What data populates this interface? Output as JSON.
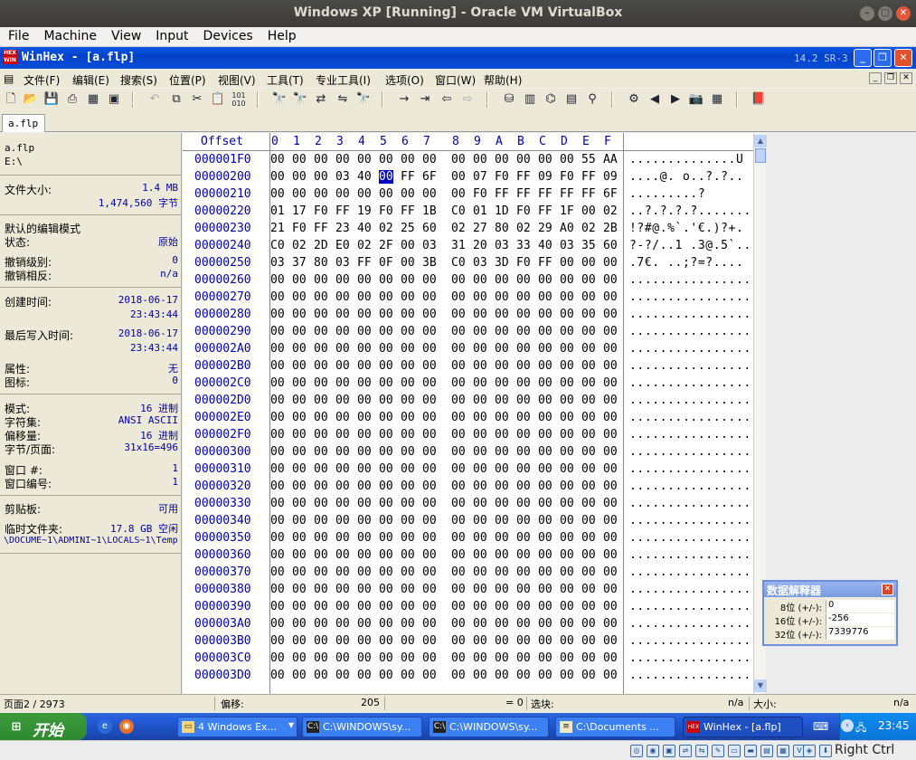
{
  "host": {
    "window_title": "Windows XP [Running] - Oracle VM VirtualBox",
    "menu": [
      "File",
      "Machine",
      "View",
      "Input",
      "Devices",
      "Help"
    ],
    "host_key": "Right Ctrl"
  },
  "app": {
    "title": "WinHex - [a.flp]",
    "version": "14.2 SR-3",
    "menu": [
      "文件(F)",
      "编辑(E)",
      "搜索(S)",
      "位置(P)",
      "视图(V)",
      "工具(T)",
      "专业工具(I)",
      "选项(O)",
      "窗口(W)",
      "帮助(H)"
    ],
    "tab_label": "a.flp"
  },
  "info": {
    "file_name": "a.flp",
    "path": "E:\\",
    "file_size_label": "文件大小:",
    "file_size_mb": "1.4 MB",
    "file_size_bytes": "1,474,560 字节",
    "default_edit_mode_label": "默认的编辑模式",
    "state_label": "状态:",
    "state_value": "原始",
    "undo_level_label": "撤销级别:",
    "undo_level_value": "0",
    "undo_reverse_label": "撤销相反:",
    "undo_reverse_value": "n/a",
    "created_label": "创建时间:",
    "created_date": "2018-06-17",
    "created_time": "23:43:44",
    "last_write_label": "最后写入时间:",
    "last_write_date": "2018-06-17",
    "last_write_time": "23:43:44",
    "attributes_label": "属性:",
    "attributes_value": "无",
    "icon_label": "图标:",
    "icon_value": "0",
    "mode_label": "模式:",
    "mode_value": "16 进制",
    "charset_label": "字符集:",
    "charset_value": "ANSI ASCII",
    "offset_label": "偏移量:",
    "offset_value": "16 进制",
    "bytes_per_page_label": "字节/页面:",
    "bytes_per_page_value": "31x16=496",
    "window_num_label": "窗口 #:",
    "window_num_value": "1",
    "window_count_label": "窗口编号:",
    "window_count_value": "1",
    "clipboard_label": "剪贴板:",
    "clipboard_value": "可用",
    "temp_folder_label": "临时文件夹:",
    "temp_folder_value": "17.8 GB 空闲",
    "temp_path": "\\DOCUME~1\\ADMINI~1\\LOCALS~1\\Temp"
  },
  "hex": {
    "offset_header": "Offset",
    "columns": [
      "0",
      "1",
      "2",
      "3",
      "4",
      "5",
      "6",
      "7",
      "8",
      "9",
      "A",
      "B",
      "C",
      "D",
      "E",
      "F"
    ],
    "rows": [
      {
        "offset": "000001F0",
        "bytes": "00 00 00 00 00 00 00 00 00 00 00 00 00 00 55 AA",
        "ascii": "..............U"
      },
      {
        "offset": "00000200",
        "bytes": "00 00 00 03 40 00 FF 6F 00 07 F0 FF 09 F0 FF 09",
        "ascii": "....@.  o..?.?.."
      },
      {
        "offset": "00000210",
        "bytes": "00 00 00 00 00 00 00 00 00 F0 FF FF FF FF FF 6F",
        "ascii": ".........?"
      },
      {
        "offset": "00000220",
        "bytes": "01 17 F0 FF 19 F0 FF 1B C0 01 1D F0 FF 1F 00 02",
        "ascii": "..?.?.?.?......."
      },
      {
        "offset": "00000230",
        "bytes": "21 F0 FF 23 40 02 25 60 02 27 80 02 29 A0 02 2B",
        "ascii": "!?#@.%`.'€.)?+."
      },
      {
        "offset": "00000240",
        "bytes": "C0 02 2D E0 02 2F 00 03 31 20 03 33 40 03 35 60",
        "ascii": "?-?/..1 .3@.5`.."
      },
      {
        "offset": "00000250",
        "bytes": "03 37 80 03 FF 0F 00 3B C0 03 3D F0 FF 00 00 00",
        "ascii": ".7€.  ..;?=?...."
      },
      {
        "offset": "00000260",
        "bytes": "00 00 00 00 00 00 00 00 00 00 00 00 00 00 00 00",
        "ascii": "................"
      },
      {
        "offset": "00000270",
        "bytes": "00 00 00 00 00 00 00 00 00 00 00 00 00 00 00 00",
        "ascii": "................"
      },
      {
        "offset": "00000280",
        "bytes": "00 00 00 00 00 00 00 00 00 00 00 00 00 00 00 00",
        "ascii": "................"
      },
      {
        "offset": "00000290",
        "bytes": "00 00 00 00 00 00 00 00 00 00 00 00 00 00 00 00",
        "ascii": "................"
      },
      {
        "offset": "000002A0",
        "bytes": "00 00 00 00 00 00 00 00 00 00 00 00 00 00 00 00",
        "ascii": "................"
      },
      {
        "offset": "000002B0",
        "bytes": "00 00 00 00 00 00 00 00 00 00 00 00 00 00 00 00",
        "ascii": "................"
      },
      {
        "offset": "000002C0",
        "bytes": "00 00 00 00 00 00 00 00 00 00 00 00 00 00 00 00",
        "ascii": "................"
      },
      {
        "offset": "000002D0",
        "bytes": "00 00 00 00 00 00 00 00 00 00 00 00 00 00 00 00",
        "ascii": "................"
      },
      {
        "offset": "000002E0",
        "bytes": "00 00 00 00 00 00 00 00 00 00 00 00 00 00 00 00",
        "ascii": "................"
      },
      {
        "offset": "000002F0",
        "bytes": "00 00 00 00 00 00 00 00 00 00 00 00 00 00 00 00",
        "ascii": "................"
      },
      {
        "offset": "00000300",
        "bytes": "00 00 00 00 00 00 00 00 00 00 00 00 00 00 00 00",
        "ascii": "................"
      },
      {
        "offset": "00000310",
        "bytes": "00 00 00 00 00 00 00 00 00 00 00 00 00 00 00 00",
        "ascii": "................"
      },
      {
        "offset": "00000320",
        "bytes": "00 00 00 00 00 00 00 00 00 00 00 00 00 00 00 00",
        "ascii": "................"
      },
      {
        "offset": "00000330",
        "bytes": "00 00 00 00 00 00 00 00 00 00 00 00 00 00 00 00",
        "ascii": "................"
      },
      {
        "offset": "00000340",
        "bytes": "00 00 00 00 00 00 00 00 00 00 00 00 00 00 00 00",
        "ascii": "................"
      },
      {
        "offset": "00000350",
        "bytes": "00 00 00 00 00 00 00 00 00 00 00 00 00 00 00 00",
        "ascii": "................"
      },
      {
        "offset": "00000360",
        "bytes": "00 00 00 00 00 00 00 00 00 00 00 00 00 00 00 00",
        "ascii": "................"
      },
      {
        "offset": "00000370",
        "bytes": "00 00 00 00 00 00 00 00 00 00 00 00 00 00 00 00",
        "ascii": "................"
      },
      {
        "offset": "00000380",
        "bytes": "00 00 00 00 00 00 00 00 00 00 00 00 00 00 00 00",
        "ascii": "................"
      },
      {
        "offset": "00000390",
        "bytes": "00 00 00 00 00 00 00 00 00 00 00 00 00 00 00 00",
        "ascii": "................"
      },
      {
        "offset": "000003A0",
        "bytes": "00 00 00 00 00 00 00 00 00 00 00 00 00 00 00 00",
        "ascii": "................"
      },
      {
        "offset": "000003B0",
        "bytes": "00 00 00 00 00 00 00 00 00 00 00 00 00 00 00 00",
        "ascii": "................"
      },
      {
        "offset": "000003C0",
        "bytes": "00 00 00 00 00 00 00 00 00 00 00 00 00 00 00 00",
        "ascii": "................"
      },
      {
        "offset": "000003D0",
        "bytes": "00 00 00 00 00 00 00 00 00 00 00 00 00 00 00 00",
        "ascii": "................"
      }
    ]
  },
  "interpreter": {
    "title": "数据解释器",
    "rows": [
      {
        "label": "8位 (+/-):",
        "value": "0"
      },
      {
        "label": "16位 (+/-):",
        "value": "-256"
      },
      {
        "label": "32位 (+/-):",
        "value": "7339776"
      }
    ]
  },
  "status": {
    "page": "页面2 / 2973",
    "offset_label": "偏移:",
    "offset_value": "205",
    "eq": "= 0",
    "selection_label": "选块:",
    "selection_value": "n/a",
    "size_label": "大小:",
    "size_value": "n/a"
  },
  "taskbar": {
    "start": "开始",
    "tasks": [
      "4 Windows Ex...",
      "C:\\WINDOWS\\sy...",
      "C:\\WINDOWS\\sy...",
      "C:\\Documents ...",
      "WinHex - [a.flp]"
    ],
    "clock": "23:45"
  },
  "icons": {
    "toolbar": [
      "new-icon",
      "open-icon",
      "save-icon",
      "print-icon",
      "properties-icon",
      "open-folder-icon",
      "undo-icon",
      "copy-icon",
      "cut-icon",
      "paste-icon",
      "binary-icon",
      "find-icon",
      "find-hex-icon",
      "replace-icon",
      "replace-hex-icon",
      "find-again-icon",
      "goto-offset-icon",
      "goto-icon",
      "back-icon",
      "forward-icon",
      "disk-icon",
      "ram-icon",
      "network-icon",
      "calculator-icon",
      "search-icon",
      "settings-icon",
      "prev-icon",
      "next-icon",
      "camera-icon",
      "table-icon",
      "help-book-icon"
    ]
  },
  "colors": {
    "xp_title": "#0442c8",
    "hex_blue": "#0000a8",
    "cursor": "#0000c0"
  }
}
